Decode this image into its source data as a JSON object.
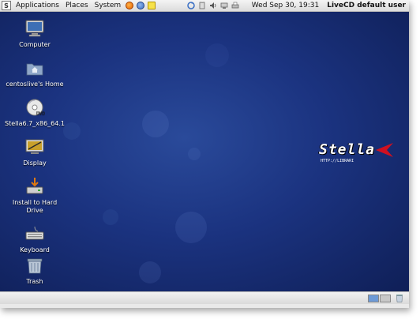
{
  "top_panel": {
    "logo_text": "S",
    "menus": [
      "Applications",
      "Places",
      "System"
    ],
    "launchers": [
      {
        "icon": "firefox-icon",
        "color": "#e66000"
      },
      {
        "icon": "browser-icon",
        "color": "#3a6fc4"
      },
      {
        "icon": "text-editor-icon",
        "color": "#e8c100"
      }
    ],
    "tray": [
      "update-icon",
      "clipboard-icon",
      "volume-icon",
      "network-icon",
      "printer-icon"
    ],
    "clock": "Wed Sep 30, 19:31",
    "user": "LiveCD default user"
  },
  "desktop": {
    "icons": [
      {
        "name": "computer-desktop-icon",
        "label": "Computer",
        "icon": "computer-icon"
      },
      {
        "name": "home-desktop-icon",
        "label": "centoslive's Home",
        "icon": "home-folder-icon"
      },
      {
        "name": "disc-desktop-icon",
        "label": "Stella6.7_x86_64.1",
        "icon": "dvd-icon"
      },
      {
        "name": "display-desktop-icon",
        "label": "Display",
        "icon": "display-icon"
      },
      {
        "name": "install-desktop-icon",
        "label": "Install to Hard Drive",
        "icon": "install-icon"
      },
      {
        "name": "keyboard-desktop-icon",
        "label": "Keyboard",
        "icon": "keyboard-icon"
      },
      {
        "name": "trash-desktop-icon",
        "label": "Trash",
        "icon": "trash-icon"
      }
    ],
    "wallpaper_logo": "Stella",
    "wallpaper_url": "HTTP://LIBRARI"
  },
  "bottom_panel": {
    "workspaces": [
      "workspace-1",
      "workspace-2"
    ],
    "trash_icon": "trash-icon"
  },
  "colors": {
    "desktop_bg": "#1b3380",
    "panel_bg": "#e5e5e5",
    "logo_red": "#d01020"
  }
}
